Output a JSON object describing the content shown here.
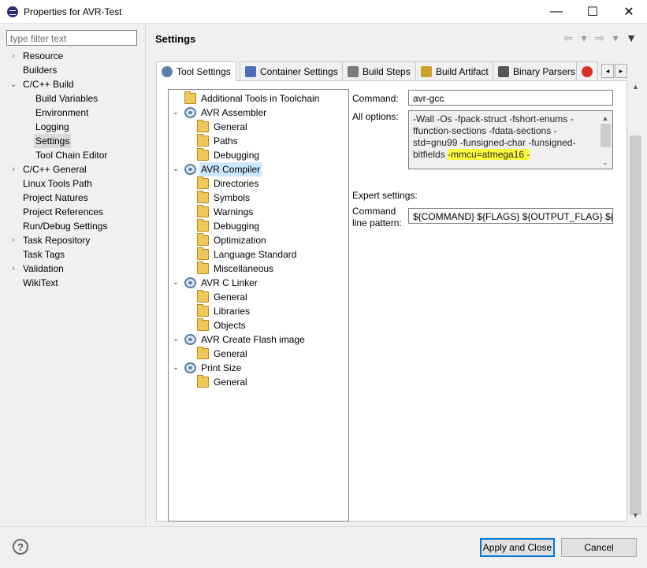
{
  "window": {
    "title": "Properties for AVR-Test",
    "minimize": "—",
    "maximize": "☐",
    "close": "✕"
  },
  "filter": {
    "placeholder": "type filter text"
  },
  "nav": [
    {
      "label": "Resource",
      "arrow": "›",
      "indent": 0
    },
    {
      "label": "Builders",
      "arrow": "",
      "indent": 0
    },
    {
      "label": "C/C++ Build",
      "arrow": "⌄",
      "indent": 0
    },
    {
      "label": "Build Variables",
      "arrow": "",
      "indent": 1
    },
    {
      "label": "Environment",
      "arrow": "",
      "indent": 1
    },
    {
      "label": "Logging",
      "arrow": "",
      "indent": 1
    },
    {
      "label": "Settings",
      "arrow": "",
      "indent": 1,
      "selected": true
    },
    {
      "label": "Tool Chain Editor",
      "arrow": "",
      "indent": 1
    },
    {
      "label": "C/C++ General",
      "arrow": "›",
      "indent": 0
    },
    {
      "label": "Linux Tools Path",
      "arrow": "",
      "indent": 0
    },
    {
      "label": "Project Natures",
      "arrow": "",
      "indent": 0
    },
    {
      "label": "Project References",
      "arrow": "",
      "indent": 0
    },
    {
      "label": "Run/Debug Settings",
      "arrow": "",
      "indent": 0
    },
    {
      "label": "Task Repository",
      "arrow": "›",
      "indent": 0
    },
    {
      "label": "Task Tags",
      "arrow": "",
      "indent": 0
    },
    {
      "label": "Validation",
      "arrow": "›",
      "indent": 0
    },
    {
      "label": "WikiText",
      "arrow": "",
      "indent": 0
    }
  ],
  "page": {
    "title": "Settings",
    "header_icons": [
      "⇦",
      "▾",
      "⇨",
      "▾",
      "▼"
    ]
  },
  "tabs": [
    {
      "label": "Tool Settings",
      "icon": "tool-settings-icon",
      "active": true
    },
    {
      "label": "Container Settings",
      "icon": "container-icon"
    },
    {
      "label": "Build Steps",
      "icon": "build-steps-icon"
    },
    {
      "label": "Build Artifact",
      "icon": "build-artifact-icon"
    },
    {
      "label": "Binary Parsers",
      "icon": "binary-parsers-icon"
    },
    {
      "label": "",
      "icon": "error-parsers-icon"
    }
  ],
  "tab_scroll": {
    "left": "◂",
    "right": "▸"
  },
  "tree": [
    {
      "label": "Additional Tools in Toolchain",
      "icon": "folder",
      "level": 0,
      "arrow": ""
    },
    {
      "label": "AVR Assembler",
      "icon": "gear",
      "level": 0,
      "arrow": "⌄"
    },
    {
      "label": "General",
      "icon": "folder",
      "level": 1,
      "arrow": ""
    },
    {
      "label": "Paths",
      "icon": "folder",
      "level": 1,
      "arrow": ""
    },
    {
      "label": "Debugging",
      "icon": "folder",
      "level": 1,
      "arrow": ""
    },
    {
      "label": "AVR Compiler",
      "icon": "gear",
      "level": 0,
      "arrow": "⌄",
      "selected": true
    },
    {
      "label": "Directories",
      "icon": "folder",
      "level": 1,
      "arrow": ""
    },
    {
      "label": "Symbols",
      "icon": "folder",
      "level": 1,
      "arrow": ""
    },
    {
      "label": "Warnings",
      "icon": "folder",
      "level": 1,
      "arrow": ""
    },
    {
      "label": "Debugging",
      "icon": "folder",
      "level": 1,
      "arrow": ""
    },
    {
      "label": "Optimization",
      "icon": "folder",
      "level": 1,
      "arrow": ""
    },
    {
      "label": "Language Standard",
      "icon": "folder",
      "level": 1,
      "arrow": ""
    },
    {
      "label": "Miscellaneous",
      "icon": "folder",
      "level": 1,
      "arrow": ""
    },
    {
      "label": "AVR C Linker",
      "icon": "gear",
      "level": 0,
      "arrow": "⌄"
    },
    {
      "label": "General",
      "icon": "folder",
      "level": 1,
      "arrow": ""
    },
    {
      "label": "Libraries",
      "icon": "folder",
      "level": 1,
      "arrow": ""
    },
    {
      "label": "Objects",
      "icon": "folder",
      "level": 1,
      "arrow": ""
    },
    {
      "label": "AVR Create Flash image",
      "icon": "gear",
      "level": 0,
      "arrow": "⌄"
    },
    {
      "label": "General",
      "icon": "folder",
      "level": 1,
      "arrow": ""
    },
    {
      "label": "Print Size",
      "icon": "gear",
      "level": 0,
      "arrow": "⌄"
    },
    {
      "label": "General",
      "icon": "folder",
      "level": 1,
      "arrow": ""
    }
  ],
  "form": {
    "command_label": "Command:",
    "command_value": "avr-gcc",
    "all_options_label": "All options:",
    "all_options_lines": [
      "-Wall -Os -fpack-struct -fshort-enums -",
      "ffunction-sections -fdata-sections -",
      "std=gnu99 -funsigned-char -funsigned-"
    ],
    "all_options_last_prefix": "bitfields ",
    "all_options_highlight": "-mmcu=atmega16 -",
    "expert_label": "Expert settings:",
    "pattern_label_1": "Command",
    "pattern_label_2": "line pattern:",
    "pattern_value": "${COMMAND} ${FLAGS} ${OUTPUT_FLAG} ${OUTPUT_PREFIX}"
  },
  "buttons": {
    "help": "?",
    "apply_close": "Apply and Close",
    "cancel": "Cancel"
  },
  "scroll": {
    "up": "▲",
    "down": "▼",
    "ta_up": "▲",
    "ta_down": "⌄"
  },
  "colors": {
    "highlight": "#ffff3c",
    "selection": "#cce8ff",
    "primary_border": "#0078d7"
  }
}
